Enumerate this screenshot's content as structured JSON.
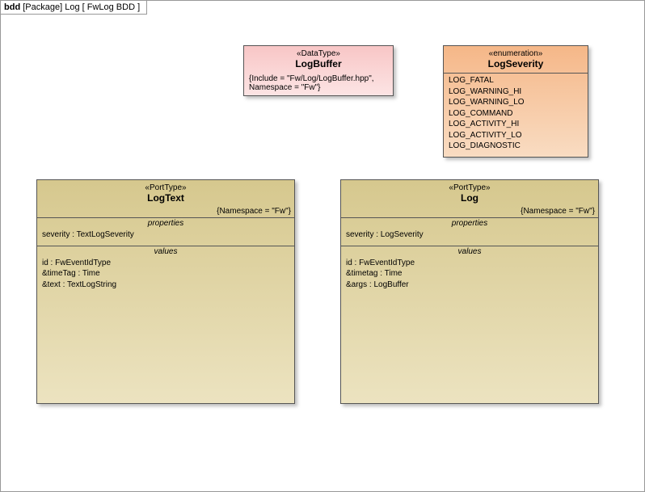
{
  "frame": {
    "prefix": "bdd",
    "label": "[Package] Log [ FwLog BDD ]"
  },
  "datatype": {
    "stereotype": "«DataType»",
    "name": "LogBuffer",
    "constraint": "{Include = \"Fw/Log/LogBuffer.hpp\",\nNamespace = \"Fw\"}"
  },
  "enumeration": {
    "stereotype": "«enumeration»",
    "name": "LogSeverity",
    "literals": [
      "LOG_FATAL",
      "LOG_WARNING_HI",
      "LOG_WARNING_LO",
      "LOG_COMMAND",
      "LOG_ACTIVITY_HI",
      "LOG_ACTIVITY_LO",
      "LOG_DIAGNOSTIC"
    ]
  },
  "portLogText": {
    "stereotype": "«PortType»",
    "name": "LogText",
    "constraint": "{Namespace = \"Fw\"}",
    "propertiesLabel": "properties",
    "properties": [
      "severity : TextLogSeverity"
    ],
    "valuesLabel": "values",
    "values": [
      "id : FwEventIdType",
      "&timeTag : Time",
      "&text : TextLogString"
    ]
  },
  "portLog": {
    "stereotype": "«PortType»",
    "name": "Log",
    "constraint": "{Namespace = \"Fw\"}",
    "propertiesLabel": "properties",
    "properties": [
      "severity : LogSeverity"
    ],
    "valuesLabel": "values",
    "values": [
      "id : FwEventIdType",
      "&timetag : Time",
      "&args : LogBuffer"
    ]
  }
}
